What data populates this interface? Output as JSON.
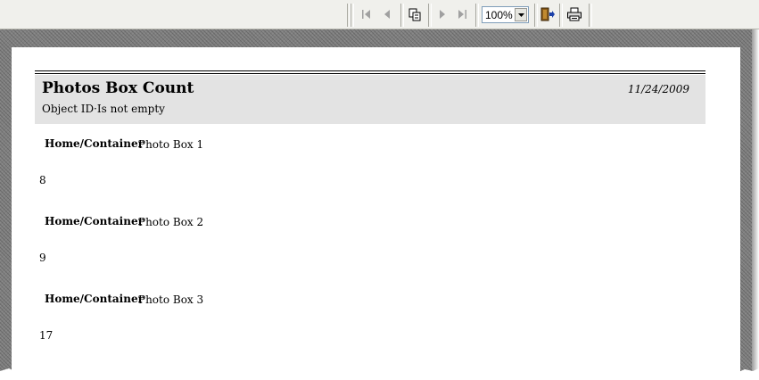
{
  "toolbar": {
    "buttons": [
      "first-page-icon",
      "previous-page-icon",
      "copy-pages-icon",
      "next-page-icon",
      "last-page-icon",
      "exit-icon",
      "print-icon"
    ],
    "zoom": "100%"
  },
  "report": {
    "title": "Photos Box Count",
    "filter": "Object ID·Is not empty",
    "date": "11/24/2009",
    "groups": [
      {
        "label": "Home/Container",
        "value": "Photo Box 1",
        "count": "8"
      },
      {
        "label": "Home/Container",
        "value": "Photo Box 2",
        "count": "9"
      },
      {
        "label": "Home/Container",
        "value": "Photo Box 3",
        "count": "17"
      }
    ]
  },
  "colors": {
    "header_band": "#e3e3e3",
    "viewport": "#808080",
    "toolbar": "#f0f0ec"
  }
}
